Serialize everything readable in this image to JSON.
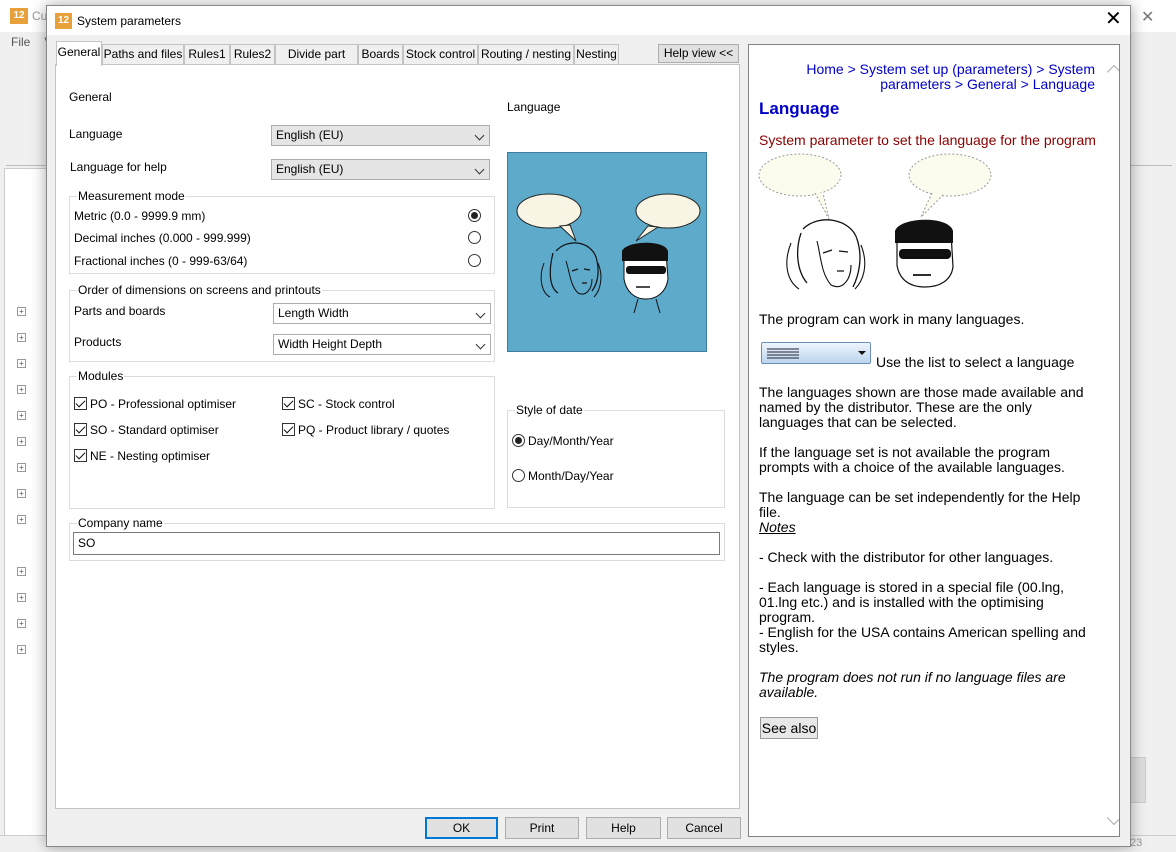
{
  "background_app": {
    "title": "Cu",
    "menu": [
      "File",
      "V"
    ],
    "tree_plus_count": 13,
    "status_right": "23"
  },
  "dialog": {
    "title": "System parameters",
    "logo_text": "12",
    "close_glyph": "✕",
    "tabs": [
      "General",
      "Paths and files",
      "Rules1",
      "Rules2",
      "Divide part lists",
      "Boards",
      "Stock control",
      "Routing / nesting",
      "Nesting"
    ],
    "active_tab": "General",
    "help_view_button": "Help view <<"
  },
  "general": {
    "section_title": "General",
    "image_caption": "Language",
    "language_label": "Language",
    "language_value": "English (EU)",
    "help_language_label": "Language for help",
    "help_language_value": "English (EU)",
    "measurement": {
      "title": "Measurement mode",
      "options": [
        "Metric (0.0 - 9999.9 mm)",
        "Decimal inches (0.000 - 999.999)",
        "Fractional inches (0 - 999-63/64)"
      ],
      "selected": 0
    },
    "dimensions": {
      "title": "Order of dimensions on screens and printouts",
      "parts_label": "Parts and boards",
      "parts_value": "Length  Width",
      "products_label": "Products",
      "products_value": "Width  Height  Depth"
    },
    "modules": {
      "title": "Modules",
      "items": [
        {
          "label": "PO - Professional optimiser",
          "checked": true
        },
        {
          "label": "SO - Standard optimiser",
          "checked": true
        },
        {
          "label": "NE - Nesting optimiser",
          "checked": true
        },
        {
          "label": "SC - Stock control",
          "checked": true
        },
        {
          "label": "PQ - Product library / quotes",
          "checked": true
        }
      ]
    },
    "date_style": {
      "title": "Style of date",
      "options": [
        "Day/Month/Year",
        "Month/Day/Year"
      ],
      "selected": 0
    },
    "company": {
      "title": "Company name",
      "value": "SO"
    }
  },
  "buttons": {
    "ok": "OK",
    "print": "Print",
    "help": "Help",
    "cancel": "Cancel"
  },
  "help": {
    "breadcrumb_line1": "Home > System set up (parameters) > System",
    "breadcrumb_line2": "parameters > General > Language",
    "heading": "Language",
    "subtitle": "System parameter to set the language for the program",
    "p1": "The program can work in many languages.",
    "select_caption": "Use the list to select a language",
    "p2": "The languages shown are those made available and named by the distributor. These are the only languages that can be selected.",
    "p3": "If the language set is not available the program prompts with a choice of the available languages.",
    "p4": "The language can be set independently for the Help file.",
    "notes_heading": "Notes",
    "n1": "- Check with the distributor for other languages.",
    "n2": "- Each language is stored in a special file (00.lng, 01.lng etc.) and is installed with the optimising program.",
    "n3": "- English for the USA contains American spelling and styles.",
    "p5": "The program does not run if no language files are available.",
    "see_also": "See also"
  },
  "colors": {
    "help_link": "#0000c8",
    "help_subtitle": "#8b0000",
    "image_bg": "#5daacb"
  }
}
